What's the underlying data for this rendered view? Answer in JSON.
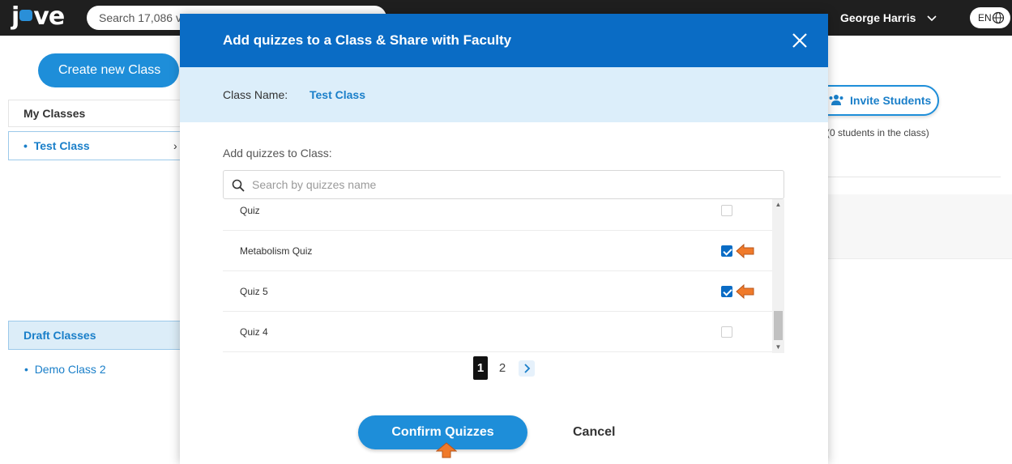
{
  "topbar": {
    "logo_text": "jove",
    "search_placeholder": "Search 17,086 v",
    "user_name": "George Harris",
    "language": "EN"
  },
  "sidebar": {
    "create_button": "Create new Class",
    "my_classes_label": "My Classes",
    "classes": [
      "Test Class"
    ],
    "draft_label": "Draft Classes",
    "draft_classes": [
      "Demo Class 2"
    ]
  },
  "class_panel": {
    "invite_button": "Invite Students",
    "students_count": "(0 students in the class)"
  },
  "modal": {
    "title": "Add quizzes to a Class & Share with Faculty",
    "class_name_label": "Class Name:",
    "class_name_value": "Test Class",
    "add_label": "Add quizzes to Class:",
    "search_placeholder": "Search by quizzes name",
    "quizzes": [
      {
        "name": "Quiz",
        "checked": false
      },
      {
        "name": "Metabolism Quiz",
        "checked": true
      },
      {
        "name": "Quiz 5",
        "checked": true
      },
      {
        "name": "Quiz 4",
        "checked": false
      }
    ],
    "pagination": {
      "current": "1",
      "next_page": "2"
    },
    "confirm_button": "Confirm Quizzes",
    "cancel_button": "Cancel"
  },
  "colors": {
    "header_blue": "#0a6cc5",
    "button_blue": "#1e8ed9",
    "band_blue": "#dceefa",
    "annotation_arrow": "#f07a2a"
  }
}
